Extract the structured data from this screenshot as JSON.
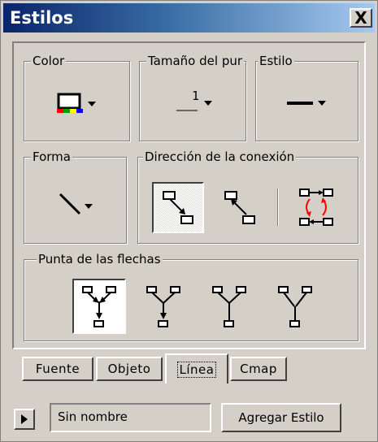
{
  "window": {
    "title": "Estilos",
    "close_glyph": "X"
  },
  "groups": {
    "color": {
      "label": "Color"
    },
    "size": {
      "label": "Tamaño del pur",
      "value": "1"
    },
    "style": {
      "label": "Estilo"
    },
    "shape": {
      "label": "Forma"
    },
    "direction": {
      "label": "Dirección de la conexión"
    },
    "arrowheads": {
      "label": "Punta de las flechas"
    }
  },
  "tabs": [
    {
      "label": "Fuente"
    },
    {
      "label": "Objeto"
    },
    {
      "label": "Línea",
      "active": true
    },
    {
      "label": "Cmap"
    }
  ],
  "bottom": {
    "style_name": "Sin nombre",
    "add_label": "Agregar Estilo"
  },
  "colors": {
    "titlebar_start": "#0a246a",
    "titlebar_end": "#a6caf0",
    "face": "#d4d0c8",
    "accent_red": "#ff0000"
  }
}
